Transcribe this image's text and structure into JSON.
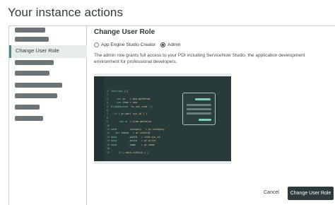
{
  "page": {
    "title": "Your instance actions"
  },
  "sidebar": {
    "active_item": "Change User Role",
    "placeholder_items": [
      "item-1",
      "item-2",
      "item-4",
      "item-5",
      "item-6",
      "item-7",
      "item-8",
      "item-9"
    ]
  },
  "dialog": {
    "heading": "Change User Role",
    "options": [
      {
        "label": "App Engine Studio Creator",
        "checked": false
      },
      {
        "label": "Admin",
        "checked": true
      }
    ],
    "description": "The admin role grants full access to your PDI including ServiceNow Studio, the application development environment for professional developers.",
    "cancel_label": "Cancel",
    "confirm_label": "Change User Role"
  },
  "colors": {
    "primary_button": "#2e3b3d",
    "active_indicator": "#4f8c7f",
    "preview_background": "#283a3a"
  }
}
